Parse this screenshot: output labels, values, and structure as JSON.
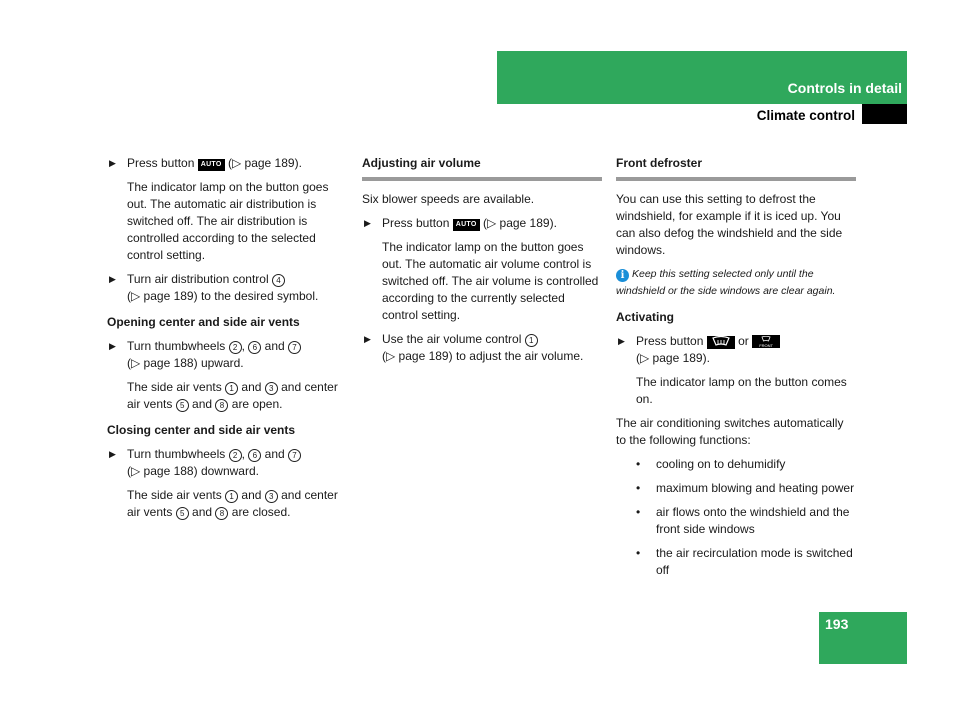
{
  "header": {
    "chapter": "Controls in detail",
    "section": "Climate control",
    "brand_color": "#2fa85c"
  },
  "page_number": "193",
  "col1": {
    "step1": {
      "pre": "Press button",
      "button": "AUTO",
      "post": "(▷ page 189)."
    },
    "step1_result": "The indicator lamp on the button goes out. The automatic air distribution is switched off. The air distribution is controlled according to the selected control setting.",
    "step2": {
      "pre": "Turn air distribution control",
      "num": "4",
      "post": "(▷ page 189) to the desired symbol."
    },
    "open_heading": "Opening center and side air vents",
    "open_step": {
      "pre": "Turn thumbwheels",
      "n1": "2",
      "n2": "6",
      "and": "and",
      "n3": "7",
      "post": "(▷ page 188) upward."
    },
    "open_result": {
      "pre": "The side air vents",
      "n1": "1",
      "mid1": "and",
      "n2": "3",
      "mid2": "and center air vents",
      "n3": "5",
      "mid3": "and",
      "n4": "8",
      "post": "are open."
    },
    "close_heading": "Closing center and side air vents",
    "close_step": {
      "pre": "Turn thumbwheels",
      "n1": "2",
      "n2": "6",
      "and": "and",
      "n3": "7",
      "post": "(▷ page 188) downward."
    },
    "close_result": {
      "pre": "The side air vents",
      "n1": "1",
      "mid1": "and",
      "n2": "3",
      "mid2": "and center air vents",
      "n3": "5",
      "mid3": "and",
      "n4": "8",
      "post": "are closed."
    }
  },
  "col2": {
    "heading": "Adjusting air volume",
    "intro": "Six blower speeds are available.",
    "step1": {
      "pre": "Press button",
      "button": "AUTO",
      "post": "(▷ page 189)."
    },
    "step1_result": "The indicator lamp on the button goes out. The automatic air volume control is switched off. The air volume is controlled according to the currently selected control setting.",
    "step2": {
      "pre": "Use the air volume control",
      "num": "1",
      "post": "(▷ page 189) to adjust the air volume."
    }
  },
  "col3": {
    "heading": "Front defroster",
    "intro": "You can use this setting to defrost the windshield, for example if it is iced up. You can also defog the windshield and the side windows.",
    "note": "Keep this setting selected only until the windshield or the side windows are clear again.",
    "activating_heading": "Activating",
    "step": {
      "pre": "Press button",
      "or": "or",
      "post": "(▷ page 189).",
      "button2_label": "FRONT"
    },
    "step_result": "The indicator lamp on the button comes on.",
    "functions_intro": "The air conditioning switches automatically to the following functions:",
    "functions": [
      "cooling on to dehumidify",
      "maximum blowing and heating power",
      "air flows onto the windshield and the front side windows",
      "the air recirculation mode is switched off"
    ]
  }
}
